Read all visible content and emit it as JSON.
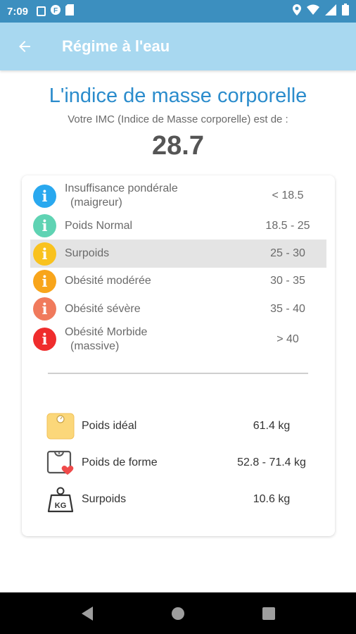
{
  "status_bar": {
    "time": "7:09"
  },
  "app_bar": {
    "title": "Régime à l'eau"
  },
  "header": {
    "title": "L'indice de masse corporelle",
    "subtitle": "Votre IMC (Indice de Masse corporelle) est de :",
    "bmi_value": "28.7"
  },
  "categories": [
    {
      "label1": "Insuffisance pondérale",
      "label2": "(maigreur)",
      "range": "< 18.5",
      "color": "#29a8ef",
      "icon": "info-icon"
    },
    {
      "label1": "Poids Normal",
      "label2": "",
      "range": "18.5 - 25",
      "color": "#5fd3b3",
      "icon": "info-icon"
    },
    {
      "label1": "Surpoids",
      "label2": "",
      "range": "25 - 30",
      "color": "#f9c21e",
      "icon": "info-icon",
      "highlighted": true
    },
    {
      "label1": "Obésité modérée",
      "label2": "",
      "range": "30 - 35",
      "color": "#f8a51b",
      "icon": "info-icon"
    },
    {
      "label1": "Obésité sévère",
      "label2": "",
      "range": "35 - 40",
      "color": "#f07a5c",
      "icon": "info-icon"
    },
    {
      "label1": "Obésité Morbide",
      "label2": "(massive)",
      "range": "> 40",
      "color": "#ef2d2d",
      "icon": "info-icon"
    }
  ],
  "weights": [
    {
      "label": "Poids idéal",
      "value": "61.4 kg",
      "icon": "scale-icon"
    },
    {
      "label": "Poids de forme",
      "value": "52.8 - 71.4 kg",
      "icon": "scale-heart-icon"
    },
    {
      "label": "Surpoids",
      "value": "10.6 kg",
      "icon": "kg-weight-icon",
      "icon_text": "KG"
    }
  ]
}
